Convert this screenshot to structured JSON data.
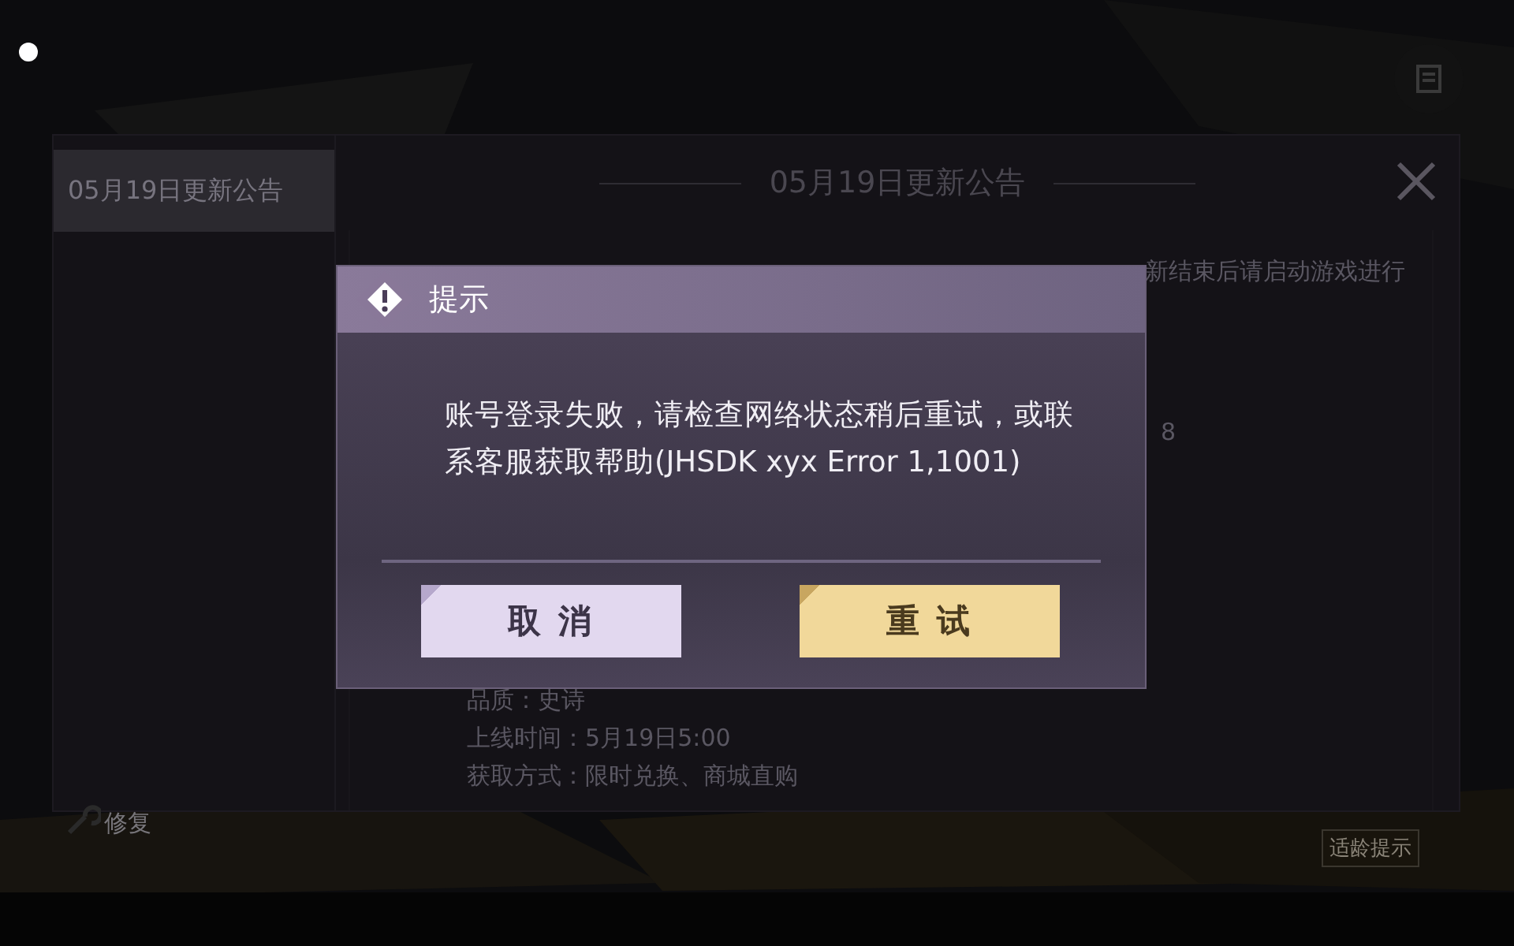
{
  "announcement": {
    "tabs": [
      {
        "label": "05月19日更新公告",
        "selected": true
      }
    ],
    "title": "05月19日更新公告",
    "content_lines": [
      {
        "text": "新结束后请启动游戏进行",
        "kind": "tail"
      },
      {
        "text": "8",
        "kind": "tail"
      },
      {
        "text": "品质：史诗",
        "kind": "full"
      },
      {
        "text": "上线时间：5月19日5:00",
        "kind": "full"
      },
      {
        "text": "获取方式：限时兑换、商城直购",
        "kind": "full"
      }
    ]
  },
  "dialog": {
    "title": "提示",
    "message": "账号登录失败，请检查网络状态稍后重试，或联系客服获取帮助(JHSDK xyx Error 1,1001)",
    "buttons": [
      {
        "label": "取 消",
        "kind": "secondary"
      },
      {
        "label": "重 试",
        "kind": "primary"
      }
    ]
  },
  "bottom": {
    "left_label": "修复",
    "age_badge": "适龄提示"
  }
}
